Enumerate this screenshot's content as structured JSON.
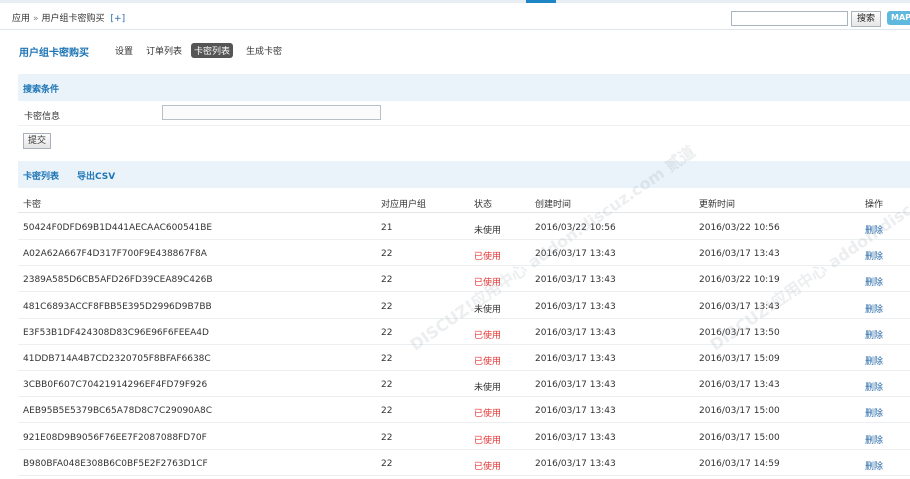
{
  "breadcrumb": {
    "root": "应用",
    "sep": "»",
    "current": "用户组卡密购买",
    "add": "[+]"
  },
  "search": {
    "button": "搜索",
    "map": "MAP"
  },
  "subnav": {
    "title": "用户组卡密购买",
    "items": [
      "设置",
      "订单列表",
      "卡密列表",
      "生成卡密"
    ],
    "active_index": 2
  },
  "search_section": {
    "title": "搜索条件",
    "field_label": "卡密信息",
    "field_value": "",
    "submit": "提交"
  },
  "list_section": {
    "title": "卡密列表",
    "export": "导出CSV"
  },
  "table": {
    "headers": [
      "卡密",
      "对应用户组",
      "状态",
      "创建时间",
      "更新时间",
      "操作"
    ],
    "rows": [
      [
        "50424F0DFD69B1D441AECAAC600541BE",
        "21",
        "未使用",
        "2016/03/22 10:56",
        "2016/03/22 10:56",
        "删除"
      ],
      [
        "A02A62A667F4D317F700F9E438867F8A",
        "22",
        "已使用",
        "2016/03/17 13:43",
        "2016/03/17 13:43",
        "删除"
      ],
      [
        "2389A585D6CB5AFD26FD39CEA89C426B",
        "22",
        "已使用",
        "2016/03/17 13:43",
        "2016/03/22 10:19",
        "删除"
      ],
      [
        "481C6893ACCF8FBB5E395D2996D9B7BB",
        "22",
        "未使用",
        "2016/03/17 13:43",
        "2016/03/17 13:43",
        "删除"
      ],
      [
        "E3F53B1DF424308D83C96E96F6FEEA4D",
        "22",
        "已使用",
        "2016/03/17 13:43",
        "2016/03/17 13:50",
        "删除"
      ],
      [
        "41DDB714A4B7CD2320705F8BFAF6638C",
        "22",
        "已使用",
        "2016/03/17 13:43",
        "2016/03/17 15:09",
        "删除"
      ],
      [
        "3CBB0F607C70421914296EF4FD79F926",
        "22",
        "未使用",
        "2016/03/17 13:43",
        "2016/03/17 13:43",
        "删除"
      ],
      [
        "AEB95B5E5379BC65A78D8C7C29090A8C",
        "22",
        "已使用",
        "2016/03/17 13:43",
        "2016/03/17 15:00",
        "删除"
      ],
      [
        "921E08D9B9056F76EE7F2087088FD70F",
        "22",
        "已使用",
        "2016/03/17 13:43",
        "2016/03/17 15:00",
        "删除"
      ],
      [
        "B980BFA048E308B6C0BF5E2F2763D1CF",
        "22",
        "已使用",
        "2016/03/17 13:43",
        "2016/03/17 14:59",
        "删除"
      ]
    ]
  },
  "watermark": "DISCUZ!应用中心 addon.discuz.com 贰道",
  "colors": {
    "accent": "#1e76b6",
    "used": "#e53535",
    "section_bg": "#eaf2fa"
  }
}
